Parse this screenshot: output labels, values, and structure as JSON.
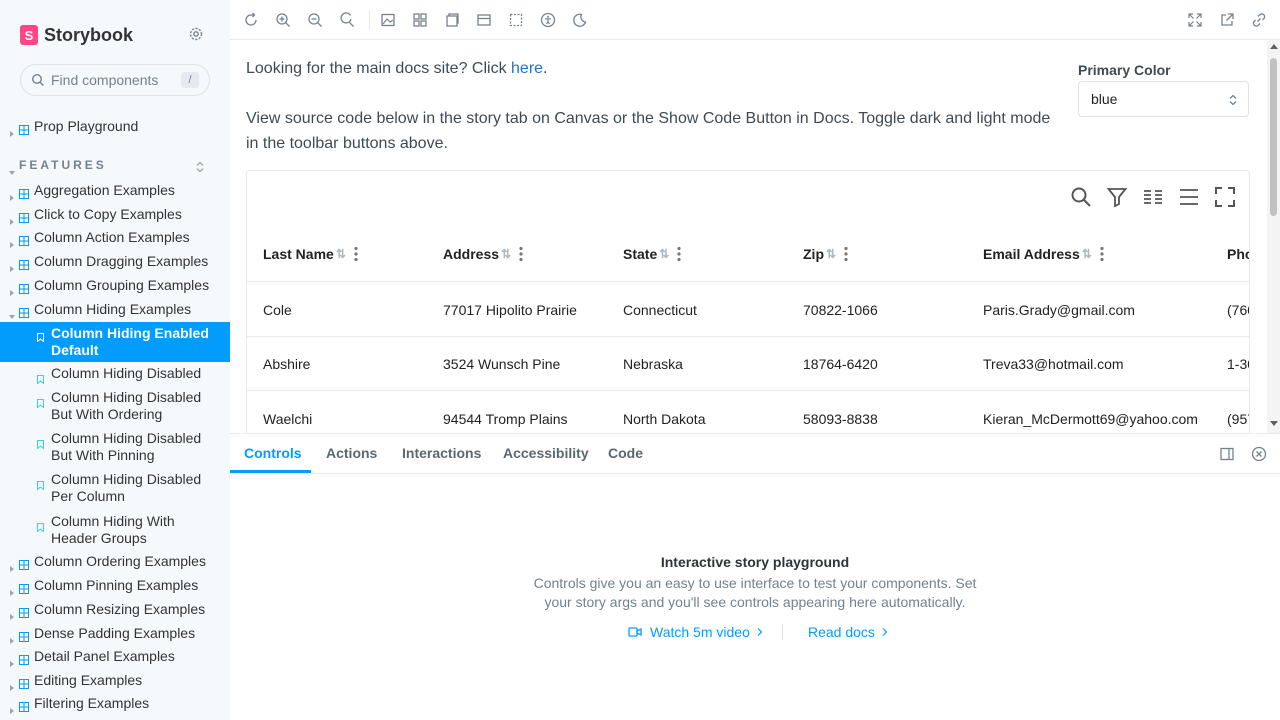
{
  "sidebar": {
    "brand": "Storybook",
    "search_placeholder": "Find components",
    "search_shortcut": "/",
    "top_items": [
      "Prop Playground"
    ],
    "section_title": "FEATURES",
    "groups_before": [
      "Aggregation Examples",
      "Click to Copy Examples",
      "Column Action Examples",
      "Column Dragging Examples",
      "Column Grouping Examples",
      "Column Hiding Examples"
    ],
    "stories": [
      "Column Hiding Enabled Default",
      "Column Hiding Disabled",
      "Column Hiding Disabled But With Ordering",
      "Column Hiding Disabled But With Pinning",
      "Column Hiding Disabled Per Column",
      "Column Hiding With Header Groups"
    ],
    "groups_after": [
      "Column Ordering Examples",
      "Column Pinning Examples",
      "Column Resizing Examples",
      "Dense Padding Examples",
      "Detail Panel Examples",
      "Editing Examples",
      "Filtering Examples"
    ]
  },
  "toolbar": {
    "left_icons": [
      "reload-icon",
      "zoom-in-icon",
      "zoom-out-icon",
      "zoom-reset-icon",
      "background-icon",
      "grid-icon",
      "measure-icon",
      "viewport-icon",
      "outline-icon",
      "accessibility-icon",
      "theme-icon"
    ],
    "right_icons": [
      "fullscreen-icon",
      "open-new-tab-icon",
      "copy-link-icon"
    ]
  },
  "canvas": {
    "intro_prefix": "Looking for the main docs site? Click ",
    "intro_link": "here",
    "intro_suffix": ".",
    "intro_2": "View source code below in the story tab on Canvas or the Show Code Button in Docs. Toggle dark and light mode in the toolbar buttons above.",
    "primary_color_label": "Primary Color",
    "primary_color_value": "blue",
    "table": {
      "columns": [
        "Last Name",
        "Address",
        "State",
        "Zip",
        "Email Address",
        "Pho"
      ],
      "rows": [
        [
          "Cole",
          "77017 Hipolito Prairie",
          "Connecticut",
          "70822-1066",
          "Paris.Grady@gmail.com",
          "(760"
        ],
        [
          "Abshire",
          "3524 Wunsch Pine",
          "Nebraska",
          "18764-6420",
          "Treva33@hotmail.com",
          "1-30"
        ],
        [
          "Waelchi",
          "94544 Tromp Plains",
          "North Dakota",
          "58093-8838",
          "Kieran_McDermott69@yahoo.com",
          "(957"
        ]
      ]
    }
  },
  "panel": {
    "tabs": [
      "Controls",
      "Actions",
      "Interactions",
      "Accessibility",
      "Code"
    ],
    "active_tab": "Controls",
    "empty_title": "Interactive story playground",
    "empty_desc": "Controls give you an easy to use interface to test your components. Set your story args and you'll see controls appearing here automatically.",
    "watch_video": "Watch 5m video",
    "read_docs": "Read docs"
  },
  "colors": {
    "accent": "#029cfd",
    "brand": "#ff4785",
    "link": "#1976d2"
  }
}
